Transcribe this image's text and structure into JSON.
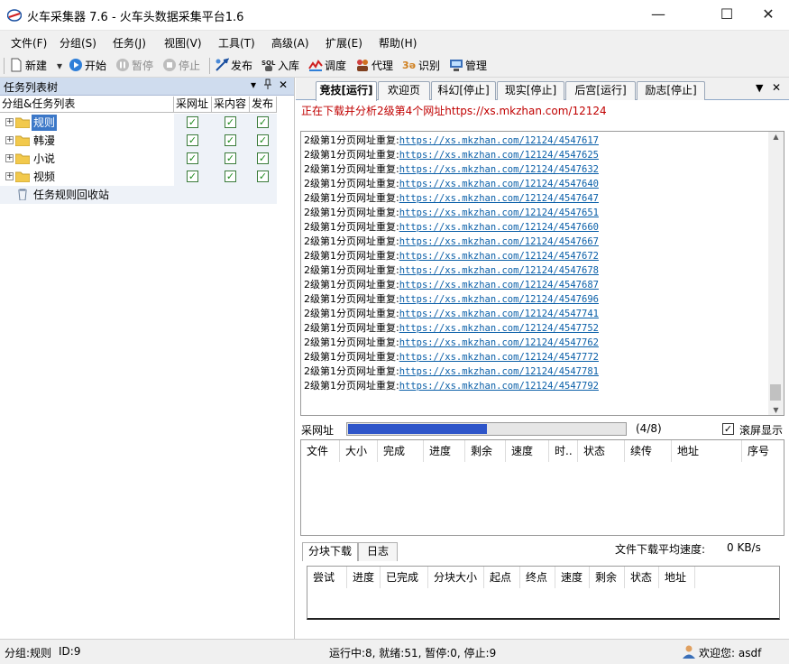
{
  "window": {
    "title": "火车采集器 7.6 - 火车头数据采集平台1.6",
    "minimize": "—",
    "maximize": "☐",
    "close": "✕"
  },
  "menu": [
    "文件(F)",
    "分组(S)",
    "任务(J)",
    "视图(V)",
    "工具(T)",
    "高级(A)",
    "扩展(E)",
    "帮助(H)"
  ],
  "toolbar": {
    "new": "新建",
    "start": "开始",
    "pause": "暂停",
    "stop": "停止",
    "publish": "发布",
    "import": "入库",
    "tune": "调度",
    "proxy": "代理",
    "recognize": "识别",
    "manage": "管理"
  },
  "left_panel": {
    "title": "任务列表树",
    "pin": "▾",
    "dock": "ᵖ",
    "close": "✕",
    "columns": [
      "分组&任务列表",
      "采网址",
      "采内容",
      "发布"
    ],
    "groups": [
      {
        "name": "规则",
        "selected": true,
        "checks": [
          true,
          true,
          true
        ]
      },
      {
        "name": "韩漫",
        "selected": false,
        "checks": [
          true,
          true,
          true
        ]
      },
      {
        "name": "小说",
        "selected": false,
        "checks": [
          true,
          true,
          true
        ]
      },
      {
        "name": "视频",
        "selected": false,
        "checks": [
          true,
          true,
          true
        ]
      }
    ],
    "recycle": "任务规则回收站"
  },
  "tabs": [
    "竞技[运行]",
    "欢迎页",
    "科幻[停止]",
    "现实[停止]",
    "后宫[运行]",
    "励志[停止]"
  ],
  "tab_controls": {
    "menu": "▼",
    "close": "✕"
  },
  "status_line": "正在下载并分析2级第4个网址https://xs.mkzhan.com/12124",
  "log": {
    "prefix": "2级第1分页网址重复:",
    "urls": [
      "https://xs.mkzhan.com/12124/4547617",
      "https://xs.mkzhan.com/12124/4547625",
      "https://xs.mkzhan.com/12124/4547632",
      "https://xs.mkzhan.com/12124/4547640",
      "https://xs.mkzhan.com/12124/4547647",
      "https://xs.mkzhan.com/12124/4547651",
      "https://xs.mkzhan.com/12124/4547660",
      "https://xs.mkzhan.com/12124/4547667",
      "https://xs.mkzhan.com/12124/4547672",
      "https://xs.mkzhan.com/12124/4547678",
      "https://xs.mkzhan.com/12124/4547687",
      "https://xs.mkzhan.com/12124/4547696",
      "https://xs.mkzhan.com/12124/4547741",
      "https://xs.mkzhan.com/12124/4547752",
      "https://xs.mkzhan.com/12124/4547762",
      "https://xs.mkzhan.com/12124/4547772",
      "https://xs.mkzhan.com/12124/4547781",
      "https://xs.mkzhan.com/12124/4547792"
    ]
  },
  "progress": {
    "label": "采网址",
    "fraction": 0.5,
    "count_text": "(4/8)",
    "autoscroll_label": "滚屏显示",
    "autoscroll_checked": true
  },
  "file_table": {
    "columns": [
      "文件",
      "大小",
      "完成",
      "进度",
      "剩余",
      "速度",
      "时..",
      "状态",
      "续传",
      "地址",
      "序号"
    ]
  },
  "sub_tabs": [
    "分块下载",
    "日志"
  ],
  "speed": {
    "label": "文件下载平均速度:",
    "value": "0 KB/s"
  },
  "block_table": {
    "columns": [
      "尝试",
      "进度",
      "已完成",
      "分块大小",
      "起点",
      "终点",
      "速度",
      "剩余",
      "状态",
      "地址"
    ]
  },
  "statusbar": {
    "group": "分组:规则",
    "id": "ID:9",
    "summary": "运行中:8, 就绪:51, 暂停:0, 停止:9",
    "welcome": "欢迎您: asdf"
  },
  "colors": {
    "selected": "#3c78c8",
    "progress": "#2e55c9",
    "status_red": "#c00000",
    "panel_header": "#cfdcee"
  }
}
